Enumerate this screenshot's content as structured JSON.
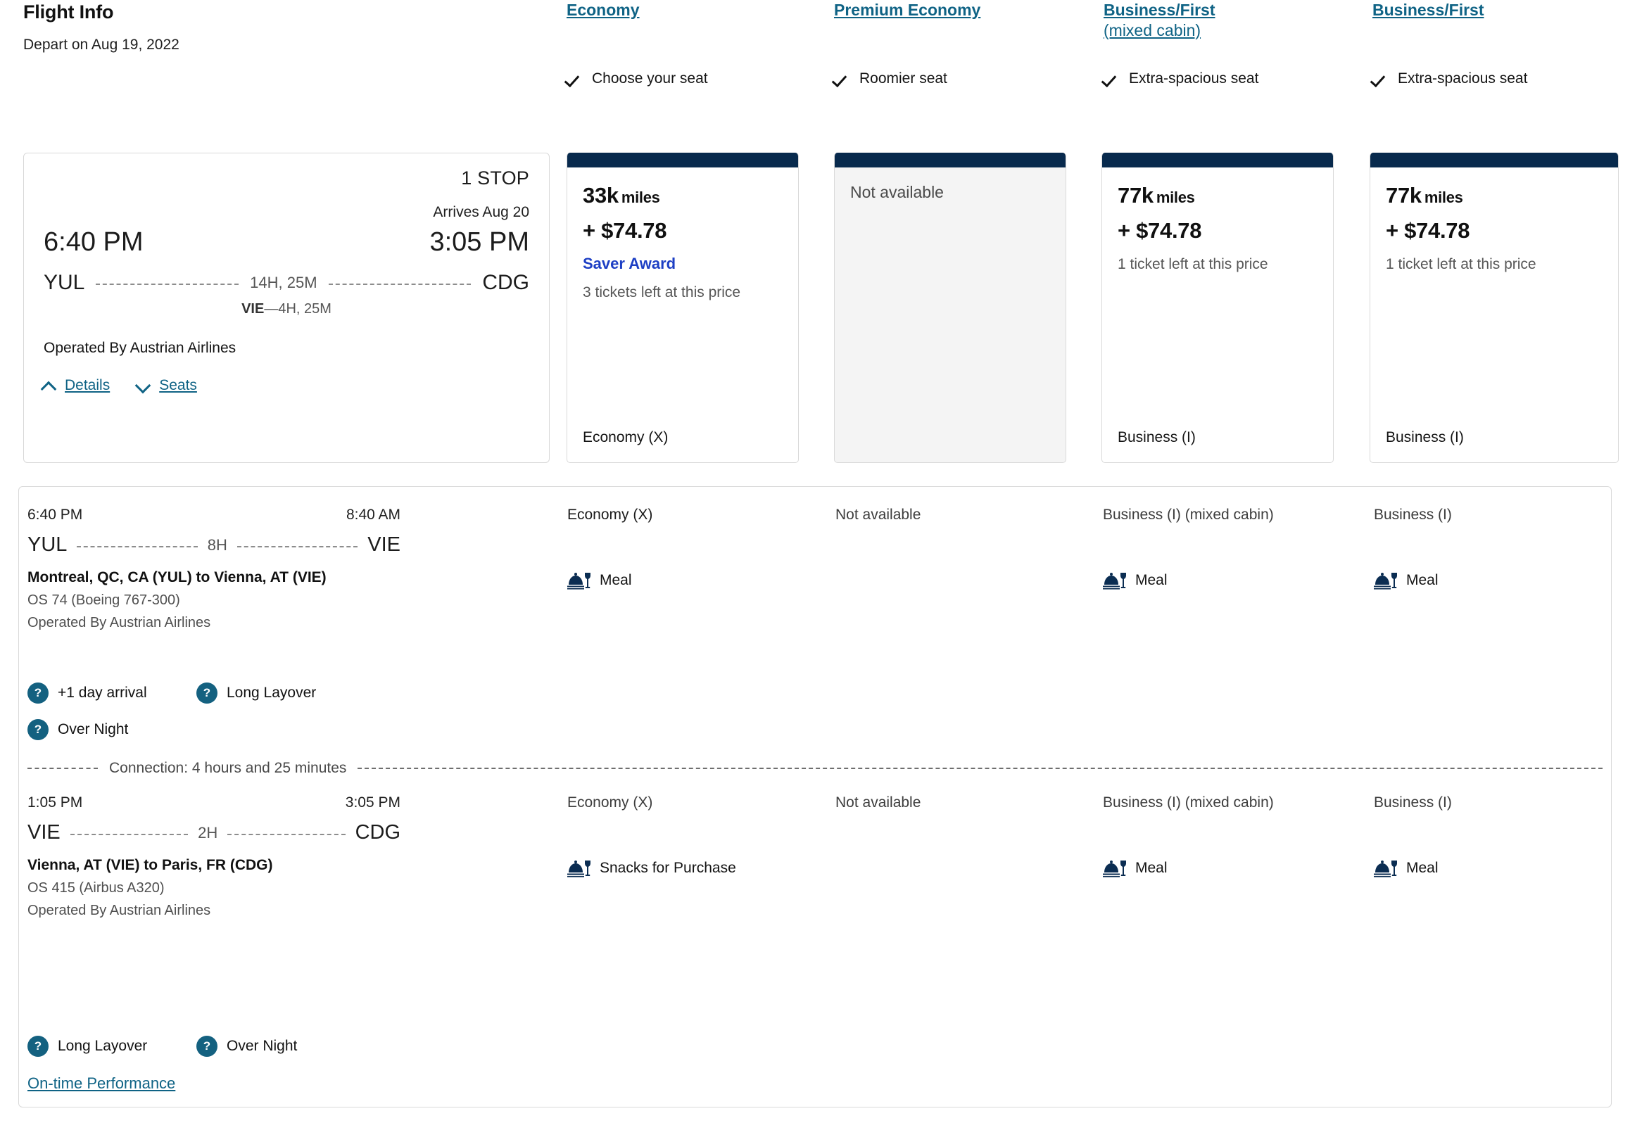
{
  "header": {
    "title": "Flight Info",
    "depart_label": "Depart on Aug 19, 2022",
    "cabins": [
      {
        "name": "Economy",
        "name2": "",
        "feature": "Choose your seat"
      },
      {
        "name": "Premium Economy",
        "name2": "",
        "feature": "Roomier seat"
      },
      {
        "name": "Business/First",
        "name2": "(mixed cabin)",
        "feature": "Extra-spacious seat"
      },
      {
        "name": "Business/First",
        "name2": "",
        "feature": "Extra-spacious seat"
      }
    ]
  },
  "flight_card": {
    "stops": "1 STOP",
    "arrives": "Arrives Aug 20",
    "depart_time": "6:40 PM",
    "arrive_time": "3:05 PM",
    "origin": "YUL",
    "destination": "CDG",
    "total_duration": "14H, 25M",
    "stopover_code": "VIE",
    "stopover_sep": "—",
    "stopover_duration": "4H, 25M",
    "operated_by": "Operated By Austrian Airlines",
    "details_label": "Details",
    "seats_label": "Seats"
  },
  "fares": [
    {
      "available": true,
      "miles": "33k",
      "miles_unit": "miles",
      "price": "+ $74.78",
      "saver": "Saver Award",
      "tickets_left": "3 tickets left at this price",
      "fare_class": "Economy (X)",
      "not_available": ""
    },
    {
      "available": false,
      "miles": "",
      "miles_unit": "",
      "price": "",
      "saver": "",
      "tickets_left": "",
      "fare_class": "",
      "not_available": "Not available"
    },
    {
      "available": true,
      "miles": "77k",
      "miles_unit": "miles",
      "price": "+ $74.78",
      "saver": "",
      "tickets_left": "1 ticket left at this price",
      "fare_class": "Business (I)",
      "not_available": ""
    },
    {
      "available": true,
      "miles": "77k",
      "miles_unit": "miles",
      "price": "+ $74.78",
      "saver": "",
      "tickets_left": "1 ticket left at this price",
      "fare_class": "Business (I)",
      "not_available": ""
    }
  ],
  "segments": [
    {
      "depart_time": "6:40 PM",
      "arrive_time": "8:40 AM",
      "origin": "YUL",
      "destination": "VIE",
      "duration": "8H",
      "city_pair": "Montreal, QC, CA (YUL) to Vienna, AT (VIE)",
      "equipment": "OS 74 (Boeing 767-300)",
      "operated_by": "Operated By Austrian Airlines",
      "cabins": [
        {
          "label": "Economy (X)",
          "meal": "Meal",
          "has_meal": true
        },
        {
          "label": "Not available",
          "meal": "",
          "has_meal": false
        },
        {
          "label": "Business (I) (mixed cabin)",
          "meal": "Meal",
          "has_meal": true
        },
        {
          "label": "Business (I)",
          "meal": "Meal",
          "has_meal": true
        }
      ],
      "badges": [
        "+1 day arrival",
        "Long Layover",
        "Over Night"
      ]
    },
    {
      "depart_time": "1:05 PM",
      "arrive_time": "3:05 PM",
      "origin": "VIE",
      "destination": "CDG",
      "duration": "2H",
      "city_pair": "Vienna, AT (VIE) to Paris, FR (CDG)",
      "equipment": "OS 415 (Airbus A320)",
      "operated_by": "Operated By Austrian Airlines",
      "cabins": [
        {
          "label": "Economy (X)",
          "meal": "Snacks for Purchase",
          "has_meal": true
        },
        {
          "label": "Not available",
          "meal": "",
          "has_meal": false
        },
        {
          "label": "Business (I) (mixed cabin)",
          "meal": "Meal",
          "has_meal": true
        },
        {
          "label": "Business (I)",
          "meal": "Meal",
          "has_meal": true
        }
      ],
      "badges": [
        "Long Layover",
        "Over Night"
      ]
    }
  ],
  "connection_text": "Connection: 4 hours and 25 minutes",
  "on_time_performance": "On-time Performance",
  "colors": {
    "navy": "#082a4d",
    "link": "#0f6385",
    "saver_blue": "#1d3fc4",
    "info_badge": "#146180",
    "border": "#d9d9d9",
    "unavailable_bg": "#f4f4f4"
  },
  "icons": {
    "check": "check-icon",
    "chevron_up": "chevron-up-icon",
    "chevron_down": "chevron-down-icon",
    "question": "question-mark-icon",
    "meal": "meal-service-icon"
  }
}
